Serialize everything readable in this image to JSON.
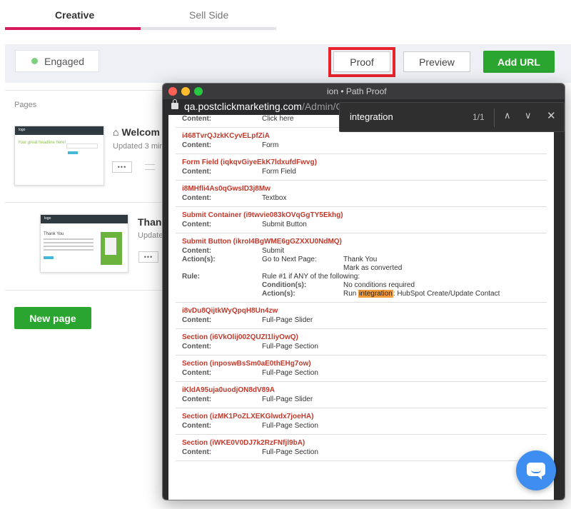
{
  "tabs": [
    {
      "label": "Creative",
      "active": true
    },
    {
      "label": "Sell Side",
      "active": false
    }
  ],
  "toolbar": {
    "status": "Engaged",
    "proof_label": "Proof",
    "preview_label": "Preview",
    "addurl_label": "Add URL"
  },
  "pages": {
    "section_label": "Pages",
    "items": [
      {
        "title": "Welcom",
        "updated": "Updated 3 min",
        "thumb_logo": "logo",
        "thumb_heading": "Your great headline here!"
      },
      {
        "title": "Thank",
        "updated": "Update",
        "thumb_logo": "logo",
        "thumb_heading": "Thank You"
      }
    ],
    "new_page_label": "New page",
    "more_label": "•••"
  },
  "browser": {
    "title": "ion • Path Proof",
    "url_host": "qa.postclickmarketing.com",
    "url_path": "/Admin/Ca"
  },
  "find": {
    "query": "integration",
    "count": "1/1",
    "up": "∧",
    "down": "∨",
    "close": "✕"
  },
  "proof": {
    "labels": {
      "content": "Content:",
      "actions": "Action(s):",
      "rule": "Rule:",
      "conditions": "Condition(s):"
    },
    "first_content": "Click here",
    "blocks": [
      {
        "id": "i468TvrQJzkKCyvELpfZiA",
        "content": "Form"
      },
      {
        "id": "Form Field (iqkqvGiyeEkK7ldxufdFwvg)",
        "content": "Form Field"
      },
      {
        "id": "i8MHfli4As0qGwsID3j8Mw",
        "content": "Textbox"
      },
      {
        "id": "Submit Container (i9twvie083kOVqGgTY5Ekhg)",
        "content": "Submit Button"
      }
    ],
    "submit": {
      "id": "Submit Button (ikroI4BgWME6gGZXXU0NdMQ)",
      "content": "Submit",
      "action_label": "Go to Next Page:",
      "action_value": "Thank You",
      "action_value2": "Mark as converted",
      "rule_value": "Rule #1 if ANY of the following:",
      "conditions_value": "No conditions required",
      "run_prefix": "Run",
      "run_highlight": "integration",
      "run_suffix": ": HubSpot Create/Update Contact"
    },
    "blocks2": [
      {
        "id": "i8vDu8QijtkWyQpqH8Un4zw",
        "content": "Full-Page Slider"
      },
      {
        "id": "Section (i6VkOlij002QUZI1liyOwQ)",
        "content": "Full-Page Section"
      },
      {
        "id": "Section (inposwBsSm0aE0thEHg7ow)",
        "content": "Full-Page Section"
      },
      {
        "id": "iKldA95uja0uodjON8dV89A",
        "content": "Full-Page Slider"
      },
      {
        "id": "Section (izMK1PoZLXEKGlwdx7joeHA)",
        "content": "Full-Page Section"
      },
      {
        "id": "Section (iWKE0V0DJ7k2RzFNfjl9bA)",
        "content": "Full-Page Section"
      }
    ]
  },
  "colors": {
    "accent_pink": "#d81b5e",
    "green": "#2aa52f",
    "highlight_red": "#e8232b",
    "id_red": "#c0392b",
    "chat_blue": "#3d8ef0"
  }
}
